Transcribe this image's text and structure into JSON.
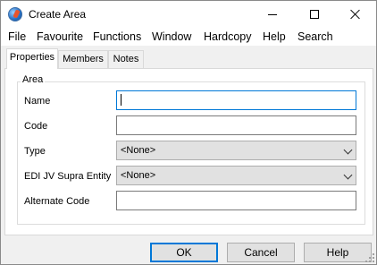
{
  "window": {
    "title": "Create Area"
  },
  "menu": [
    "File",
    "Favourite",
    "Functions",
    "Window",
    "Hardcopy",
    "Help",
    "Search"
  ],
  "tabs": [
    "Properties",
    "Members",
    "Notes"
  ],
  "active_tab": "Properties",
  "group": {
    "label": "Area"
  },
  "fields": {
    "name": {
      "label": "Name",
      "value": ""
    },
    "code": {
      "label": "Code",
      "value": ""
    },
    "type": {
      "label": "Type",
      "value": "<None>"
    },
    "edi": {
      "label": "EDI JV Supra Entity",
      "value": "<None>"
    },
    "alternate_code": {
      "label": "Alternate Code",
      "value": ""
    }
  },
  "buttons": {
    "ok": "OK",
    "cancel": "Cancel",
    "help": "Help"
  },
  "colors": {
    "accent": "#0078d7",
    "dialog_bg": "#f0f0f0",
    "button_bg": "#e1e1e1"
  },
  "icons": {
    "app": "globe-app-icon",
    "minimize": "minimize-icon",
    "maximize": "maximize-icon",
    "close": "close-icon",
    "dropdown": "chevron-down-icon"
  }
}
